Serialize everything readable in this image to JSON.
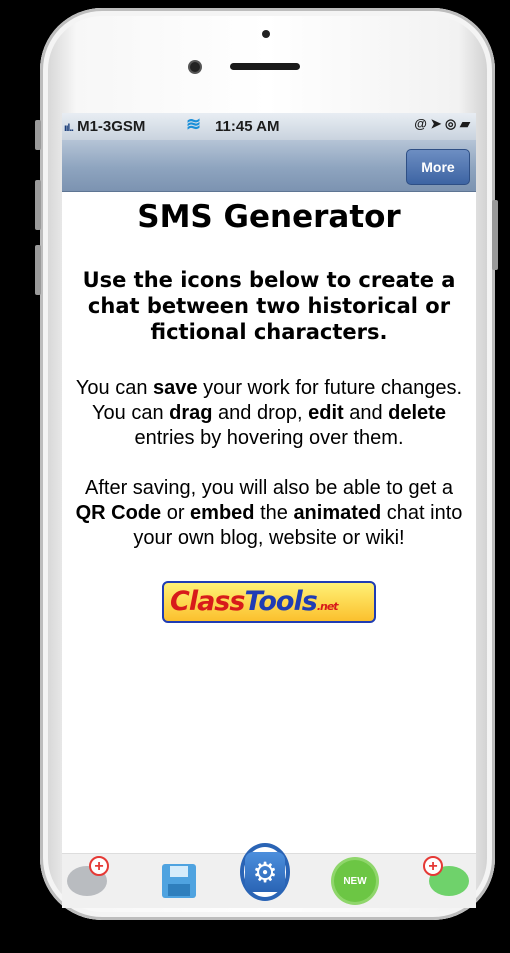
{
  "status_bar": {
    "carrier": "M1-3GSM",
    "signal_bars": "ııl..",
    "wifi_icon": "wifi-icon",
    "time": "11:45 AM",
    "status_icons": "@ ➤ ◎ ▰"
  },
  "nav": {
    "more_label": "More"
  },
  "content": {
    "title": "SMS Generator",
    "subtitle": "Use the icons below to create a chat between two historical or fictional characters.",
    "para1": {
      "t1": "You can ",
      "b1": "save",
      "t2": " your work for future changes. You can ",
      "b2": "drag",
      "t3": " and drop, ",
      "b3": "edit",
      "t4": " and ",
      "b4": "delete",
      "t5": " entries by hovering over them."
    },
    "para2": {
      "t1": "After saving, you will also be able to get a ",
      "b1": "QR Code",
      "t2": " or ",
      "b2": "embed",
      "t3": " the ",
      "b3": "animated",
      "t4": " chat into your own blog, website or wiki!"
    },
    "logo": {
      "part1": "Class",
      "part2": "Tools",
      "suffix": ".net"
    }
  },
  "toolbar": {
    "add_left_icon": "add-chat-bubble-icon",
    "save_icon": "floppy-disk-icon",
    "settings_icon": "gear-icon",
    "gear_glyph": "⚙",
    "new_label": "NEW",
    "add_right_icon": "add-chat-bubble-icon",
    "plus_glyph": "+"
  },
  "colors": {
    "nav_bar": "#8ea4bf",
    "more_button": "#4a72b0",
    "settings_accent": "#2a64b5",
    "new_badge": "#6cc644"
  }
}
